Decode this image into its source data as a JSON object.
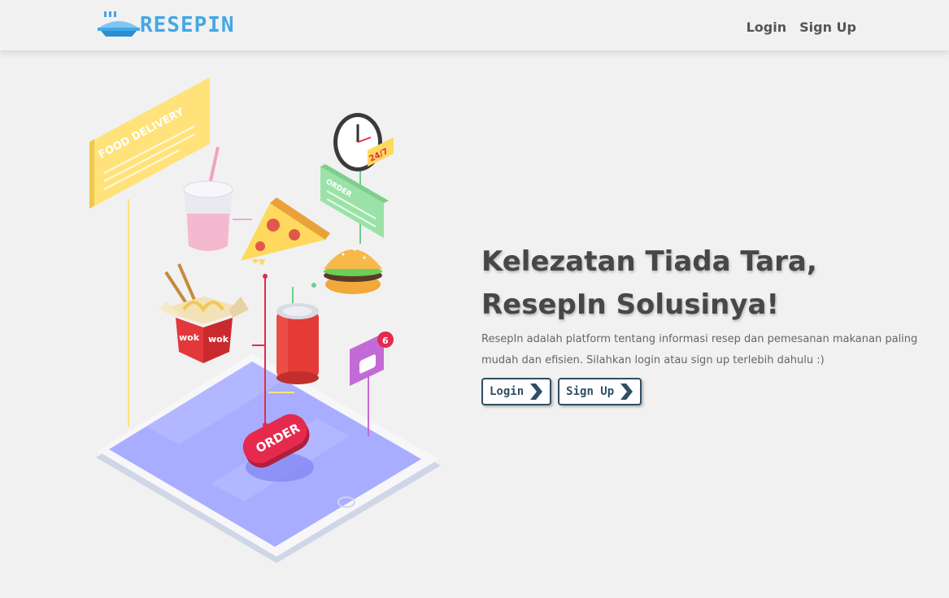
{
  "brand": {
    "name": "ResepIn",
    "logo_icon": "boat-dish-icon"
  },
  "nav": {
    "login": "Login",
    "signup": "Sign Up"
  },
  "hero": {
    "headline_line1": "Kelezatan Tiada Tara,",
    "headline_line2": "ResepIn Solusinya!",
    "description": "ResepIn adalah platform tentang informasi resep dan pemesanan makanan paling mudah dan efisien. Silahkan login atau sign up terlebih dahulu :)",
    "login_button": "Login",
    "signup_button": "Sign Up"
  },
  "illustration": {
    "food_delivery_sign": "FOOD DELIVERY",
    "order_card": "ORDER",
    "clock_badge": "24/7",
    "order_button": "ORDER",
    "wok_text": "wok",
    "notification_count": "6"
  },
  "colors": {
    "accent_blue": "#43a7e6",
    "text_dark": "#474747",
    "button_border": "#2f4f66",
    "tablet_screen": "#a9adff",
    "order_red": "#e52a4d"
  }
}
